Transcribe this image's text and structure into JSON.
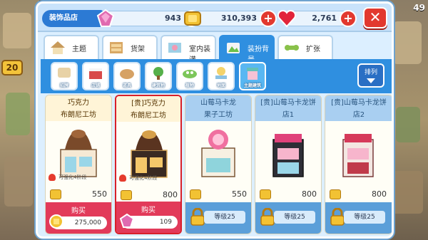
{
  "header": {
    "shop_title": "装饰品店",
    "gems": "943",
    "coins": "310,393",
    "hearts": "2,761",
    "close_label": "✕"
  },
  "background": {
    "level": "20",
    "right_count": "49"
  },
  "tabs": [
    {
      "label": "主题",
      "active": false
    },
    {
      "label": "货架",
      "active": false
    },
    {
      "label": "室内装潢",
      "active": false
    },
    {
      "label": "装扮背景",
      "active": true
    },
    {
      "label": "扩张",
      "active": false
    }
  ],
  "filters": [
    {
      "label": "招牌",
      "active": false
    },
    {
      "label": "店铺",
      "active": false
    },
    {
      "label": "道具",
      "active": false
    },
    {
      "label": "建筑物",
      "active": false
    },
    {
      "label": "植物",
      "active": false
    },
    {
      "label": "地面",
      "active": false
    },
    {
      "label": "主题建筑",
      "active": true
    }
  ],
  "sort_label": "排列",
  "items": [
    {
      "name_line1": "巧克力",
      "name_line2": "布朗尼工坊",
      "upgrade": "可强化4阶段",
      "price": "550",
      "action": "购买",
      "cost": "275,000",
      "cost_type": "coin",
      "locked": false,
      "selected": false
    },
    {
      "name_line1": "[贵]巧克力",
      "name_line2": "布朗尼工坊",
      "upgrade": "可强化4阶段",
      "price": "800",
      "action": "购买",
      "cost": "109",
      "cost_type": "gem",
      "locked": false,
      "selected": true
    },
    {
      "name_line1": "山莓马卡龙",
      "name_line2": "果子工坊",
      "upgrade": "",
      "price": "550",
      "level_req": "等级25",
      "locked": true,
      "selected": false
    },
    {
      "name_line1": "[贵]山莓马卡龙饼",
      "name_line2": "店1",
      "upgrade": "",
      "price": "800",
      "level_req": "等级25",
      "locked": true,
      "selected": false
    },
    {
      "name_line1": "[贵]山莓马卡龙饼",
      "name_line2": "店2",
      "upgrade": "",
      "price": "800",
      "level_req": "等级25",
      "locked": true,
      "selected": false
    }
  ],
  "colors": {
    "accent_blue": "#2f8fe0",
    "buy_red": "#e23a5a",
    "lock_blue": "#5b9fd9",
    "close_red": "#e2392f"
  }
}
